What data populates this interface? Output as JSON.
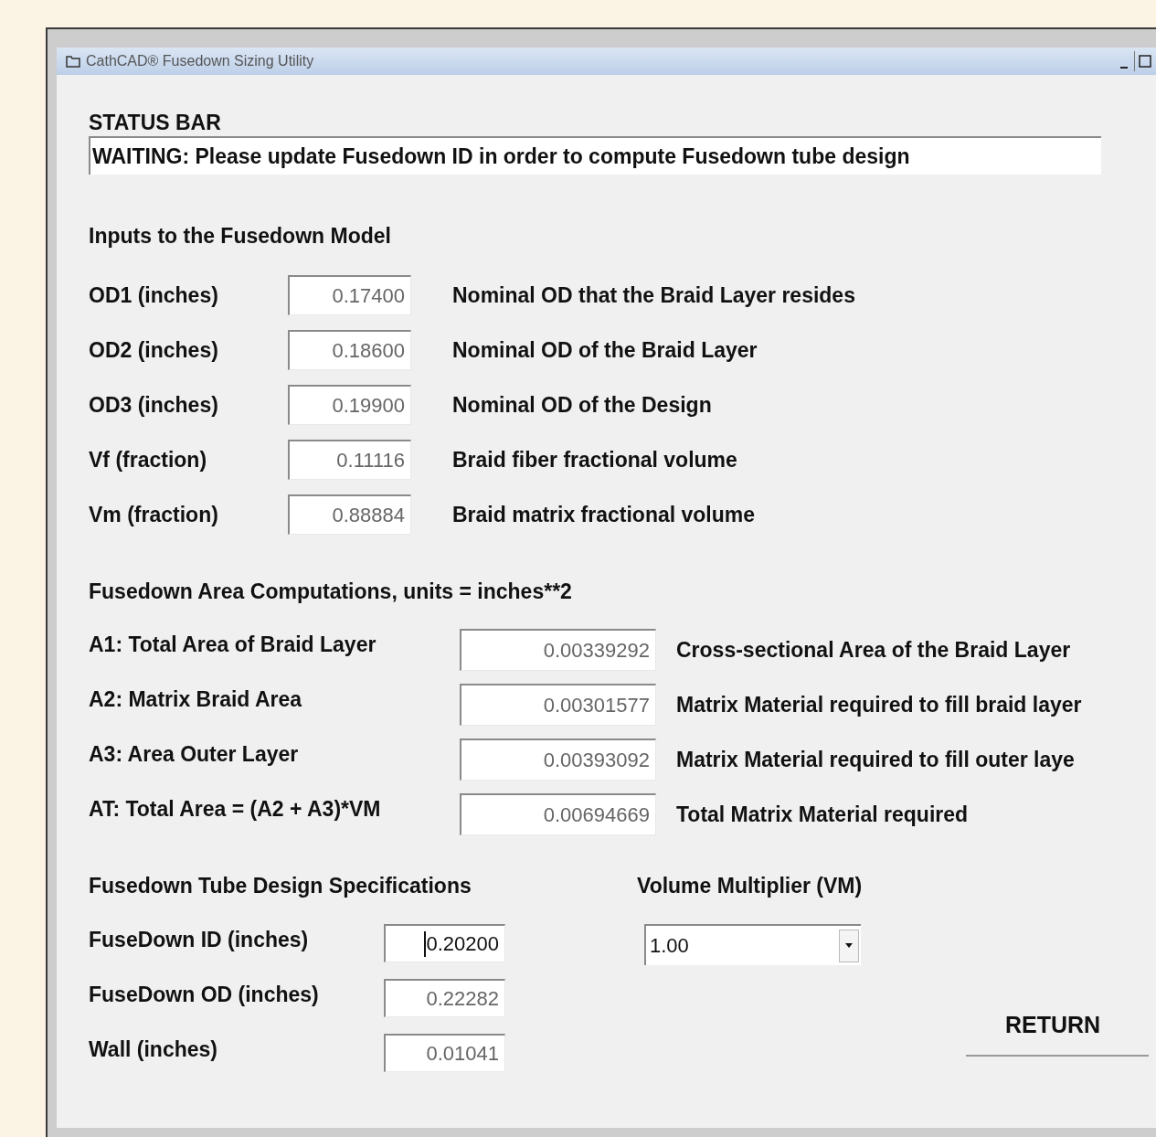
{
  "window": {
    "title": "CathCAD® Fusedown Sizing Utility"
  },
  "status_bar": {
    "label": "STATUS BAR",
    "value": "WAITING: Please update Fusedown ID in order to compute Fusedown tube design"
  },
  "inputs": {
    "heading": "Inputs to the Fusedown Model",
    "rows": [
      {
        "label": "OD1 (inches)",
        "value": "0.17400",
        "description": "Nominal OD that the Braid Layer resides"
      },
      {
        "label": "OD2 (inches)",
        "value": "0.18600",
        "description": "Nominal OD of the Braid Layer"
      },
      {
        "label": "OD3 (inches)",
        "value": "0.19900",
        "description": "Nominal OD of the Design"
      },
      {
        "label": "Vf (fraction)",
        "value": "0.11116",
        "description": "Braid fiber fractional volume"
      },
      {
        "label": "Vm (fraction)",
        "value": "0.88884",
        "description": "Braid matrix fractional volume"
      }
    ]
  },
  "areas": {
    "heading": "Fusedown Area Computations, units = inches**2",
    "rows": [
      {
        "label": "A1: Total Area of Braid Layer",
        "value": "0.00339292",
        "description": "Cross-sectional Area of the Braid Layer"
      },
      {
        "label": "A2: Matrix Braid Area",
        "value": "0.00301577",
        "description": "Matrix Material required to fill braid layer"
      },
      {
        "label": "A3: Area Outer Layer",
        "value": "0.00393092",
        "description": "Matrix Material required to fill outer laye"
      },
      {
        "label": "AT: Total Area = (A2 + A3)*VM",
        "value": "0.00694669",
        "description": "Total Matrix Material required"
      }
    ]
  },
  "design": {
    "heading": "Fusedown Tube Design Specifications",
    "rows": [
      {
        "label": "FuseDown ID (inches)",
        "value": "0.20200",
        "editable": true
      },
      {
        "label": "FuseDown OD (inches)",
        "value": "0.22282",
        "editable": false
      },
      {
        "label": "Wall (inches)",
        "value": "0.01041",
        "editable": false
      }
    ]
  },
  "volume_multiplier": {
    "label": "Volume Multiplier (VM)",
    "value": "1.00"
  },
  "buttons": [
    "RETURN"
  ]
}
